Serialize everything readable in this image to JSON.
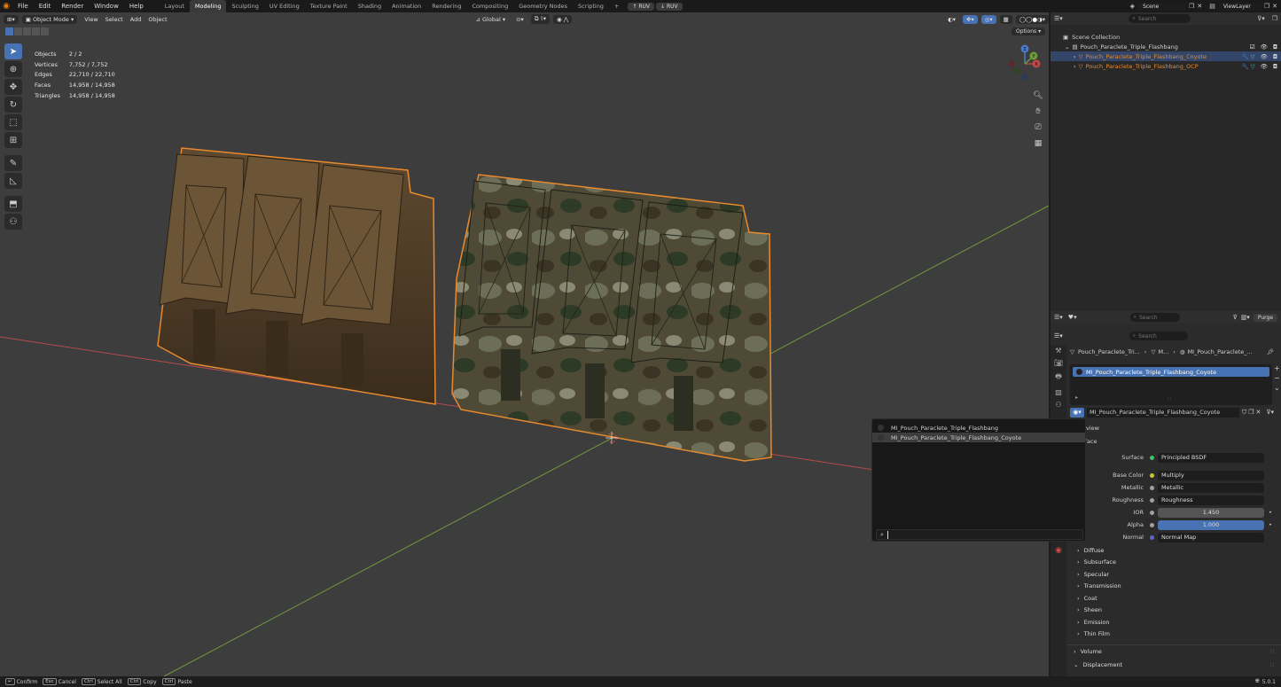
{
  "topbar": {
    "menus": [
      "File",
      "Edit",
      "Render",
      "Window",
      "Help"
    ],
    "workspaces": [
      "Layout",
      "Modeling",
      "Sculpting",
      "UV Editing",
      "Texture Paint",
      "Shading",
      "Animation",
      "Rendering",
      "Compositing",
      "Geometry Nodes",
      "Scripting"
    ],
    "active_workspace": "Modeling",
    "add_tab": "+",
    "ruv_buttons": [
      "RUV",
      "RUV"
    ],
    "scene": "Scene",
    "view_layer": "ViewLayer"
  },
  "viewport": {
    "mode": "Object Mode",
    "menus": [
      "View",
      "Select",
      "Add",
      "Object"
    ],
    "orientation": "Global",
    "options": "Options",
    "stats": [
      {
        "label": "Objects",
        "value": "2 / 2"
      },
      {
        "label": "Vertices",
        "value": "7,752 / 7,752"
      },
      {
        "label": "Edges",
        "value": "22,710 / 22,710"
      },
      {
        "label": "Faces",
        "value": "14,958 / 14,958"
      },
      {
        "label": "Triangles",
        "value": "14,958 / 14,958"
      }
    ],
    "gizmo": {
      "x": "X",
      "y": "Y",
      "z": "Z"
    }
  },
  "outliner": {
    "search_placeholder": "Search",
    "collection": "Scene Collection",
    "parent": "Pouch_Paraclete_Triple_Flashbang",
    "objects": [
      "Pouch_Paraclete_Triple_Flashbang_Coyote",
      "Pouch_Paraclete_Triple_Flashbang_OCP"
    ]
  },
  "properties": {
    "search_placeholder": "Search",
    "search2_placeholder": "Search",
    "purge": "Purge",
    "breadcrumb": [
      "Pouch_Paraclete_Tri...",
      "M...",
      "MI_Pouch_Paraclete_..."
    ],
    "slot": "MI_Pouch_Paraclete_Triple_Flashbang_Coyote",
    "material": "MI_Pouch_Paraclete_Triple_Flashbang_Coyote",
    "preview": "eview",
    "surface_header": "rface",
    "fields": [
      {
        "label": "Surface",
        "value": "Principled BSDF",
        "dot": "#3ec26a",
        "kind": "link"
      },
      {
        "label": "Base Color",
        "value": "Multiply",
        "dot": "#c7c729",
        "kind": "link"
      },
      {
        "label": "Metallic",
        "value": "Metallic",
        "dot": "#a1a1a1",
        "kind": "link"
      },
      {
        "label": "Roughness",
        "value": "Roughness",
        "dot": "#a1a1a1",
        "kind": "link"
      },
      {
        "label": "IOR",
        "value": "1.450",
        "dot": "#a1a1a1",
        "kind": "num"
      },
      {
        "label": "Alpha",
        "value": "1.000",
        "dot": "#a1a1a1",
        "kind": "blue"
      },
      {
        "label": "Normal",
        "value": "Normal Map",
        "dot": "#6363c7",
        "kind": "link"
      }
    ],
    "sections": [
      "Diffuse",
      "Subsurface",
      "Specular",
      "Transmission",
      "Coat",
      "Sheen",
      "Emission",
      "Thin Film"
    ],
    "bottom_sections": [
      "Volume",
      "Displacement"
    ]
  },
  "popup": {
    "items": [
      "MI_Pouch_Paraclete_Triple_Flashbang",
      "MI_Pouch_Paraclete_Triple_Flashbang_Coyote"
    ],
    "highlighted": 1
  },
  "status": {
    "items": [
      {
        "key": "↵",
        "label": "Confirm"
      },
      {
        "key": "Esc",
        "label": "Cancel"
      },
      {
        "key": "Ctrl",
        "label": "Select All"
      },
      {
        "key": "Ctrl",
        "label": "Copy"
      },
      {
        "key": "Ctrl",
        "label": "Paste"
      }
    ],
    "version": "5.0.1"
  },
  "colors": {
    "accent": "#4772b3",
    "selection_outline": "#e88a2e",
    "x_axis": "#b84a4a",
    "y_axis": "#6f9a3a"
  }
}
